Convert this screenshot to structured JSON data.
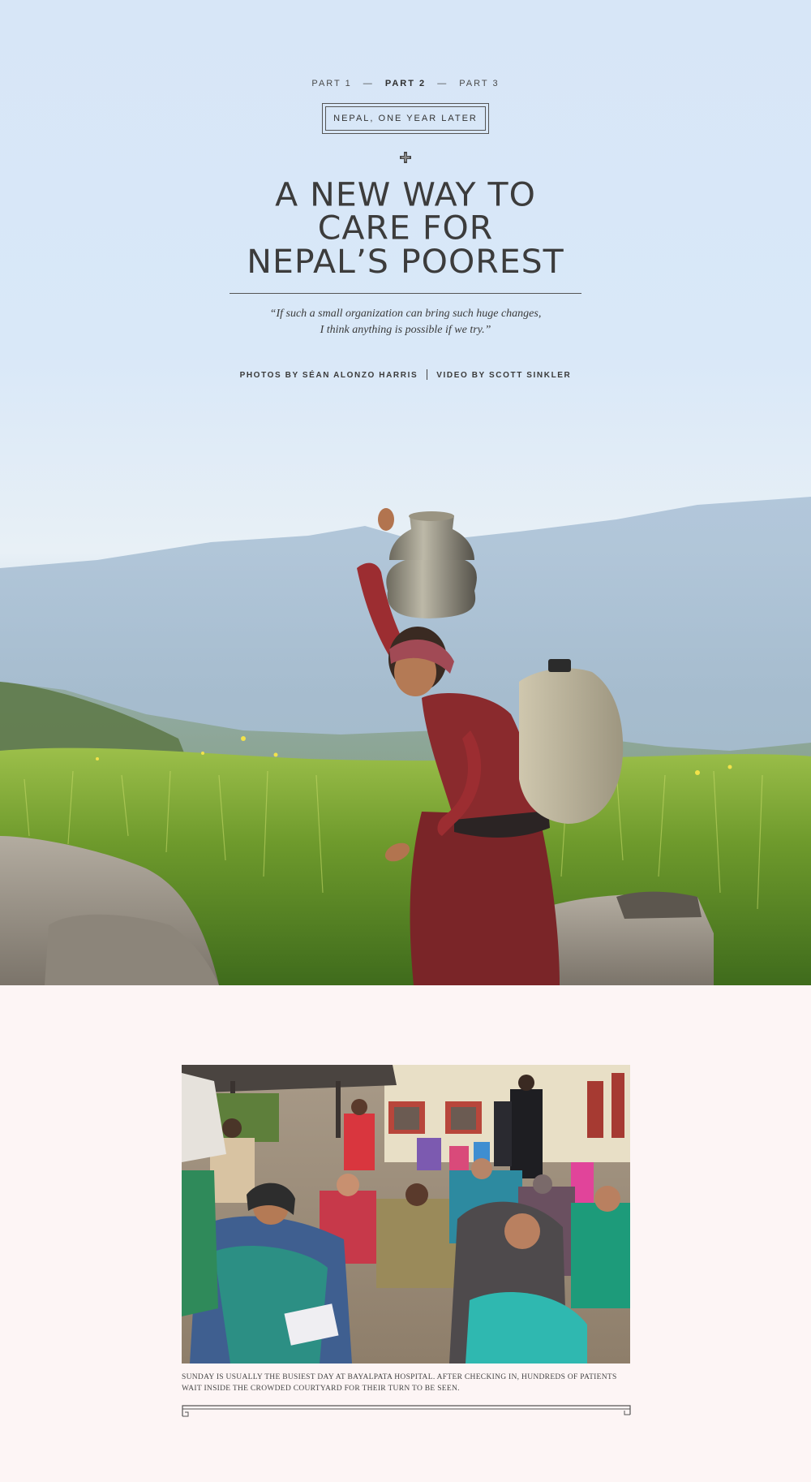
{
  "parts_nav": {
    "part1": "PART 1",
    "sep1": "—",
    "part2": "PART 2",
    "sep2": "—",
    "part3": "PART 3"
  },
  "series_label": "NEPAL, ONE YEAR LATER",
  "headline": {
    "line1": "A NEW WAY TO",
    "line2": "CARE FOR",
    "line3": "NEPAL’S POOREST"
  },
  "pull_quote": {
    "line1": "“If such a small organization can bring such huge changes,",
    "line2": "I think anything is possible if we try.”"
  },
  "credits": {
    "photos": "PHOTOS BY SÉAN ALONZO HARRIS",
    "video": "VIDEO BY SCOTT SINKLER"
  },
  "caption": "SUNDAY IS USUALLY THE BUSIEST DAY AT BAYALPATA HOSPITAL. AFTER CHECKING IN, HUNDREDS OF PATIENTS WAIT INSIDE THE CROWDED COURTYARD FOR THEIR TURN TO BE SEEN.",
  "colors": {
    "sky": "#d7e6f7",
    "page_background": "#fdf5f5",
    "text": "#3f3f3f"
  }
}
